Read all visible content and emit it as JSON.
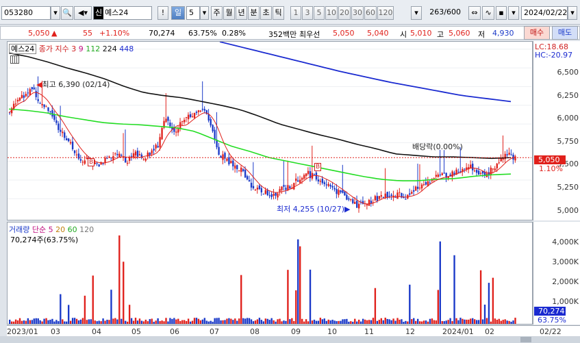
{
  "toolbar": {
    "code": "053280",
    "badge": "신",
    "name": "예스24",
    "alert": "!",
    "period": "일",
    "period_count": "5",
    "periods": [
      "주",
      "월",
      "년",
      "분",
      "초",
      "틱"
    ],
    "ticks": [
      "1",
      "3",
      "5",
      "10",
      "20",
      "30",
      "60",
      "120"
    ],
    "count": "263",
    "total": "/600",
    "date": "2024/02/22"
  },
  "info": {
    "price": "5,050",
    "arrow": "▲",
    "change": "55",
    "change_pct": "+1.10%",
    "volume": "70,274",
    "vol_ratio": "63.75%",
    "turnover": "0.28%",
    "amount": "352백만",
    "best_label": "최우선",
    "ask": "5,050",
    "bid": "5,040",
    "low_label": "시",
    "open": "5,010",
    "high_label": "고",
    "high": "5,060",
    "low2_label": "저",
    "low": "4,930",
    "buy": "매수",
    "sell": "매도"
  },
  "price_panel": {
    "name": "예스24",
    "indicator": "종가 지수",
    "ma_labels": [
      "3",
      "9",
      "112",
      "224",
      "448"
    ],
    "lc": "LC:18.68",
    "hc": "HC:-20.97",
    "yticks": [
      "6,500",
      "6,250",
      "6,000",
      "5,750",
      "5,500",
      "5,250",
      "5,000",
      "4,750",
      "4,500",
      "4,250"
    ],
    "current": "5,050",
    "current_pct": "1.10%",
    "annot_high": "최고 6,390 (02/14)",
    "annot_low": "최저 4,255 (10/27)",
    "annot_div": "배당락(0.00%)",
    "marker_b": "B"
  },
  "volume_panel": {
    "title": "거래량",
    "ma_title": "단순",
    "ma_labels": [
      "5",
      "20",
      "60",
      "120"
    ],
    "summary": "70,274주(63.75%)",
    "yticks": [
      "4,000K",
      "3,000K",
      "2,000K",
      "1,000K"
    ],
    "current": "70,274",
    "current_pct": "63.75%"
  },
  "xaxis": [
    "2023/01",
    "03",
    "04",
    "05",
    "06",
    "07",
    "08",
    "09",
    "10",
    "11",
    "12",
    "2024/01",
    "02",
    "02/22"
  ],
  "colors": {
    "up": "#e0201b",
    "down": "#1a39c8",
    "ma_short": "#e0201b",
    "ma_green": "#22dd22",
    "ma_black": "#111111",
    "ma_blue": "#1a2ad0"
  },
  "chart_data": {
    "type": "candlestick",
    "ylim": [
      4200,
      6600
    ],
    "series": [
      {
        "name": "종가",
        "values": [
          5650,
          5850,
          5900,
          6000,
          5750,
          5700,
          5500,
          5350,
          5200,
          5050,
          5000,
          4950,
          5000,
          5050,
          5100,
          5000,
          5100,
          5050,
          5100,
          5200,
          5600,
          5400,
          5500,
          5600,
          5650,
          5700,
          5400,
          5100,
          5000,
          4950,
          4850,
          4700,
          4600,
          4600,
          4550,
          4650,
          4650,
          4750,
          4850,
          4800,
          4750,
          4700,
          4600,
          4550,
          4450,
          4400,
          4450,
          4500,
          4550,
          4500,
          4550,
          4500,
          4600,
          4700,
          4750,
          4800,
          4800,
          4850,
          4900,
          4950,
          4850,
          4800,
          4900,
          5000,
          5100,
          5050
        ]
      },
      {
        "name": "ma_green",
        "values": [
          5700,
          5680,
          5650,
          5600,
          5560,
          5520,
          5500,
          5490,
          5470,
          5450,
          5400,
          5300,
          5200,
          5130,
          5050,
          5000,
          4950,
          4900,
          4850,
          4800,
          4760,
          4740,
          4740,
          4760,
          4770,
          4800,
          4820,
          4830
        ]
      },
      {
        "name": "ma_black",
        "values": [
          6450,
          6400,
          6330,
          6250,
          6180,
          6100,
          6000,
          5920,
          5880,
          5850,
          5800,
          5750,
          5690,
          5600,
          5500,
          5430,
          5360,
          5300,
          5230,
          5170,
          5100,
          5080,
          5060,
          5060,
          5050,
          5040,
          5050
        ]
      },
      {
        "name": "ma_blue",
        "values": [
          6600,
          6520,
          6440,
          6360,
          6280,
          6200,
          6130,
          6060,
          6000,
          5940,
          5880,
          5840,
          5800
        ]
      }
    ]
  }
}
